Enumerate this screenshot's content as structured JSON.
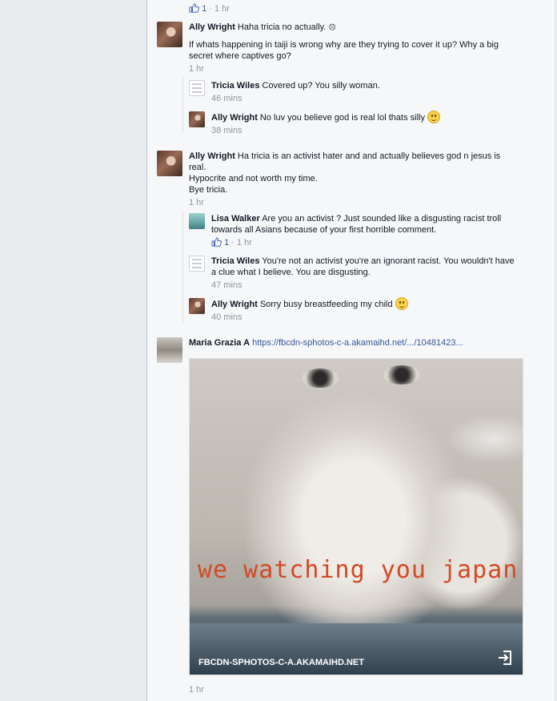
{
  "thread": {
    "top": {
      "like_count": "1",
      "sep": "·",
      "time": "1 hr"
    },
    "c1": {
      "author": "Ally Wright",
      "text": "Haha tricia no actually.",
      "text2": "If whats happening in taiji is wrong why are they trying to cover it up? Why a big secret where captives go?",
      "time": "1 hr"
    },
    "r1": {
      "author": "Tricia Wiles",
      "text": "Covered up? You silly woman.",
      "time": "46 mins"
    },
    "r2": {
      "author": "Ally Wright",
      "text": "No luv you believe god is real lol thats silly",
      "time": "38 mins"
    },
    "c2": {
      "author": "Ally Wright",
      "text": "Ha tricia is an activist hater and and actually believes god n jesus is real.",
      "text2": "Hypocrite and not worth my time.",
      "text3": "Bye tricia.",
      "time": "1 hr"
    },
    "r3": {
      "author": "Lisa Walker",
      "text": "Are you an activist ? Just sounded like a disgusting racist troll towards all Asians because of your first horrible comment.",
      "like_count": "1",
      "sep": "·",
      "time": "1 hr"
    },
    "r4": {
      "author": "Tricia Wiles",
      "text": "You're not an activist you're an ignorant racist. You wouldn't have a clue what I believe. You are disgusting.",
      "time": "47 mins"
    },
    "r5": {
      "author": "Ally Wright",
      "text": "Sorry busy breastfeeding my child",
      "time": "40 mins"
    },
    "c3": {
      "author": "Maria Grazia A",
      "link": "https://fbcdn-sphotos-c-a.akamaihd.net/.../10481423...",
      "photo_caption": "we watching you japan",
      "photo_domain": "FBCDN-SPHOTOS-C-A.AKAMAIHD.NET",
      "time": "1 hr"
    }
  },
  "icons": {
    "like": "thumbs-up-icon",
    "emoji_wink": "wink-emoji-icon",
    "emoji_smile": "smile-emoji-icon",
    "share": "share-arrow-icon"
  },
  "colors": {
    "link": "#365899",
    "meta": "#90949c",
    "panel": "#f6f7f9",
    "caption": "#d24a24"
  }
}
